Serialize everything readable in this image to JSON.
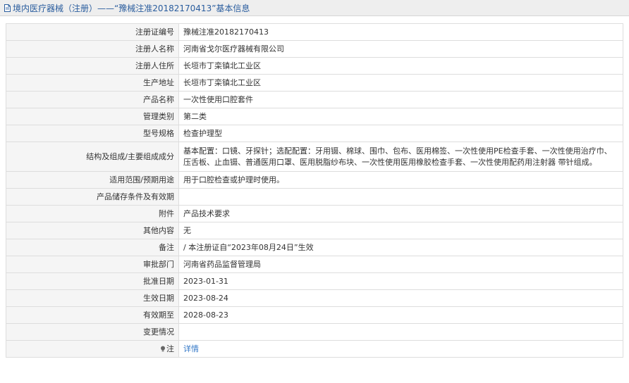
{
  "header": {
    "title": "境内医疗器械（注册）——“豫械注准20182170413”基本信息"
  },
  "rows": [
    {
      "label": "注册证编号",
      "value": "豫械注准20182170413"
    },
    {
      "label": "注册人名称",
      "value": "河南省戈尔医疗器械有限公司"
    },
    {
      "label": "注册人住所",
      "value": "长垣市丁栾镇北工业区"
    },
    {
      "label": "生产地址",
      "value": "长垣市丁栾镇北工业区"
    },
    {
      "label": "产品名称",
      "value": "一次性使用口腔套件"
    },
    {
      "label": "管理类别",
      "value": "第二类"
    },
    {
      "label": "型号规格",
      "value": "检查护理型"
    },
    {
      "label": "结构及组成/主要组成成分",
      "value": "基本配置：口镜、牙探针；选配配置：牙用镊、棉球、围巾、包布、医用棉签、一次性使用PE检查手套、一次性使用治疗巾、压舌板、止血镊、普通医用口罩、医用脱脂纱布块、一次性使用医用橡胶检查手套、一次性使用配药用注射器 带针组成。"
    },
    {
      "label": "适用范围/预期用途",
      "value": "用于口腔检查或护理时使用。"
    },
    {
      "label": "产品储存条件及有效期",
      "value": ""
    },
    {
      "label": "附件",
      "value": "产品技术要求"
    },
    {
      "label": "其他内容",
      "value": "无"
    },
    {
      "label": "备注",
      "value": "/ 本注册证自“2023年08月24日”生效"
    },
    {
      "label": "审批部门",
      "value": "河南省药品监督管理局"
    },
    {
      "label": "批准日期",
      "value": "2023-01-31"
    },
    {
      "label": "生效日期",
      "value": "2023-08-24"
    },
    {
      "label": "有效期至",
      "value": "2028-08-23"
    },
    {
      "label": "变更情况",
      "value": ""
    },
    {
      "label": "注",
      "value": "详情"
    }
  ],
  "icons": {
    "header_icon": "document-icon",
    "note_icon": "lightbulb-icon"
  },
  "colors": {
    "header_text": "#2a5d9e",
    "link": "#3478c7",
    "label_bg": "#f5f5f5",
    "border": "#dddddd"
  }
}
